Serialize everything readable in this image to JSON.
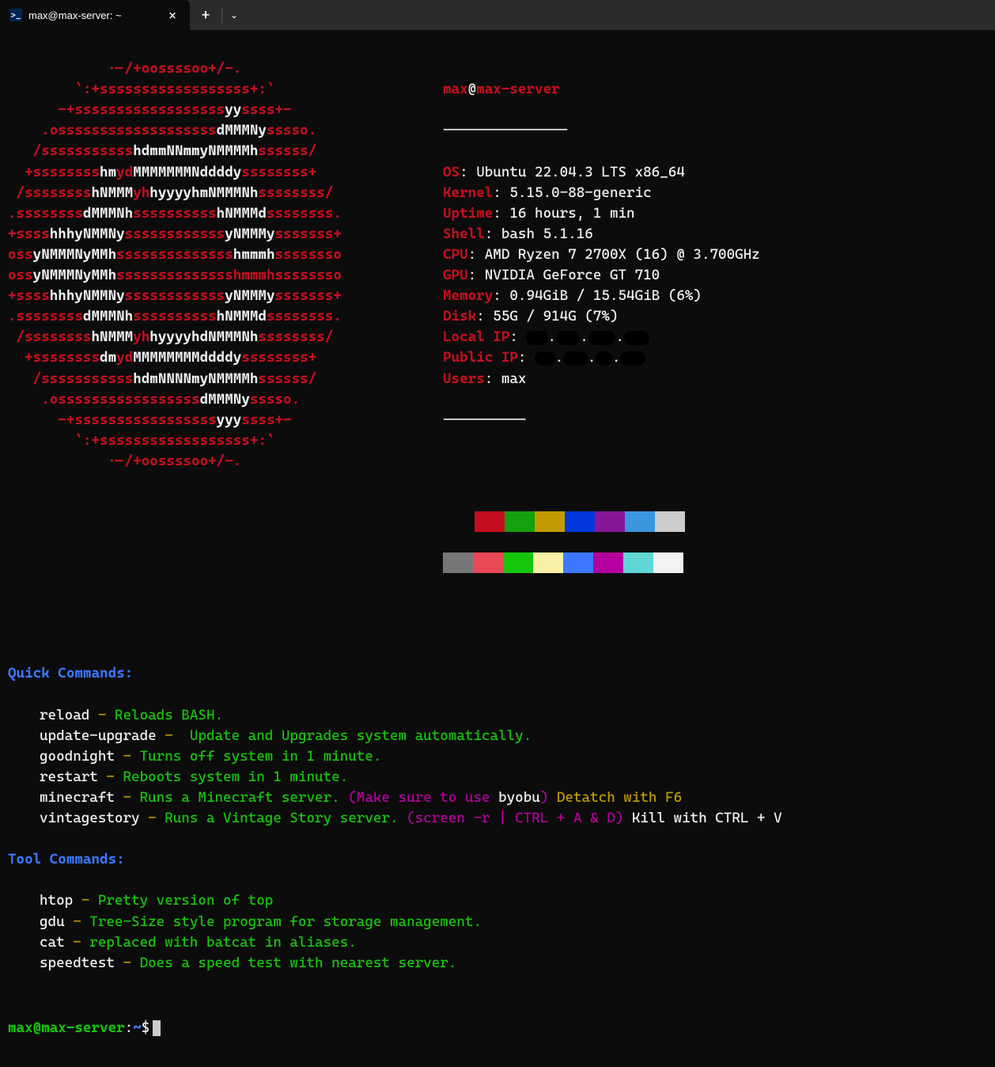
{
  "tab": {
    "title": "max@max-server: ~"
  },
  "logo": [
    [
      {
        "t": "            .-/+oossssoo+/-.",
        "c": "red"
      }
    ],
    [
      {
        "t": "        `:+ssssssssssssssssss+:`",
        "c": "red"
      }
    ],
    [
      {
        "t": "      -+ssssssssssssssssss",
        "c": "red"
      },
      {
        "t": "yy",
        "c": "wht"
      },
      {
        "t": "ssss+-",
        "c": "red"
      }
    ],
    [
      {
        "t": "    .osssssssssssssssssss",
        "c": "red"
      },
      {
        "t": "dMMMNy",
        "c": "wht"
      },
      {
        "t": "sssso.",
        "c": "red"
      }
    ],
    [
      {
        "t": "   /sssssssssss",
        "c": "red"
      },
      {
        "t": "hdmmNNmmyNMMMMh",
        "c": "wht"
      },
      {
        "t": "ssssss/",
        "c": "red"
      }
    ],
    [
      {
        "t": "  +ssssssss",
        "c": "red"
      },
      {
        "t": "hm",
        "c": "wht"
      },
      {
        "t": "yd",
        "c": "red"
      },
      {
        "t": "MMMMMMMNddddy",
        "c": "wht"
      },
      {
        "t": "ssssssss+",
        "c": "red"
      }
    ],
    [
      {
        "t": " /ssssssss",
        "c": "red"
      },
      {
        "t": "hNMMM",
        "c": "wht"
      },
      {
        "t": "yh",
        "c": "red"
      },
      {
        "t": "hyyyyhmNMMMNh",
        "c": "wht"
      },
      {
        "t": "ssssssss/",
        "c": "red"
      }
    ],
    [
      {
        "t": ".ssssssss",
        "c": "red"
      },
      {
        "t": "dMMMNh",
        "c": "wht"
      },
      {
        "t": "ssssssssss",
        "c": "red"
      },
      {
        "t": "hNMMMd",
        "c": "wht"
      },
      {
        "t": "ssssssss.",
        "c": "red"
      }
    ],
    [
      {
        "t": "+ssss",
        "c": "red"
      },
      {
        "t": "hhhyNMMNy",
        "c": "wht"
      },
      {
        "t": "ssssssssssss",
        "c": "red"
      },
      {
        "t": "yNMMMy",
        "c": "wht"
      },
      {
        "t": "sssssss+",
        "c": "red"
      }
    ],
    [
      {
        "t": "oss",
        "c": "red"
      },
      {
        "t": "yNMMMNyMMh",
        "c": "wht"
      },
      {
        "t": "ssssssssssssss",
        "c": "red"
      },
      {
        "t": "hmmmh",
        "c": "wht"
      },
      {
        "t": "ssssssso",
        "c": "red"
      }
    ],
    [
      {
        "t": "oss",
        "c": "red"
      },
      {
        "t": "yNMMMNyMMh",
        "c": "wht"
      },
      {
        "t": "sssssssssssssshmmmh",
        "c": "red"
      },
      {
        "t": "ssssssso",
        "c": "red"
      }
    ],
    [
      {
        "t": "+ssss",
        "c": "red"
      },
      {
        "t": "hhhyNMMNy",
        "c": "wht"
      },
      {
        "t": "ssssssssssss",
        "c": "red"
      },
      {
        "t": "yNMMMy",
        "c": "wht"
      },
      {
        "t": "sssssss+",
        "c": "red"
      }
    ],
    [
      {
        "t": ".ssssssss",
        "c": "red"
      },
      {
        "t": "dMMMNh",
        "c": "wht"
      },
      {
        "t": "ssssssssss",
        "c": "red"
      },
      {
        "t": "hNMMMd",
        "c": "wht"
      },
      {
        "t": "ssssssss.",
        "c": "red"
      }
    ],
    [
      {
        "t": " /ssssssss",
        "c": "red"
      },
      {
        "t": "hNMMM",
        "c": "wht"
      },
      {
        "t": "yh",
        "c": "red"
      },
      {
        "t": "hyyyyhdNMMMNh",
        "c": "wht"
      },
      {
        "t": "ssssssss/",
        "c": "red"
      }
    ],
    [
      {
        "t": "  +ssssssss",
        "c": "red"
      },
      {
        "t": "dm",
        "c": "wht"
      },
      {
        "t": "yd",
        "c": "red"
      },
      {
        "t": "MMMMMMMMddddy",
        "c": "wht"
      },
      {
        "t": "ssssssss+",
        "c": "red"
      }
    ],
    [
      {
        "t": "   /sssssssssss",
        "c": "red"
      },
      {
        "t": "hdmNNNNmyNMMMMh",
        "c": "wht"
      },
      {
        "t": "ssssss/",
        "c": "red"
      }
    ],
    [
      {
        "t": "    .osssssssssssssssss",
        "c": "red"
      },
      {
        "t": "dMMMNy",
        "c": "wht"
      },
      {
        "t": "sssso.",
        "c": "red"
      }
    ],
    [
      {
        "t": "      -+sssssssssssssssss",
        "c": "red"
      },
      {
        "t": "yyy",
        "c": "wht"
      },
      {
        "t": "ssss+-",
        "c": "red"
      }
    ],
    [
      {
        "t": "        `:+ssssssssssssssssss+:`",
        "c": "red"
      }
    ],
    [
      {
        "t": "            .-/+oossssoo+/-.",
        "c": "red"
      }
    ]
  ],
  "header": {
    "user": "max",
    "at": "@",
    "host": "max-server",
    "sep": "---------------"
  },
  "info": [
    {
      "label": "OS",
      "value": "Ubuntu 22.04.3 LTS x86_64"
    },
    {
      "label": "Kernel",
      "value": "5.15.0-88-generic"
    },
    {
      "label": "Uptime",
      "value": "16 hours, 1 min"
    },
    {
      "label": "Shell",
      "value": "bash 5.1.16"
    },
    {
      "label": "CPU",
      "value": "AMD Ryzen 7 2700X (16) @ 3.700GHz"
    },
    {
      "label": "GPU",
      "value": "NVIDIA GeForce GT 710"
    },
    {
      "label": "Memory",
      "value": "0.94GiB / 15.54GiB (6%)"
    },
    {
      "label": "Disk",
      "value": "55G / 914G (7%)"
    },
    {
      "label": "Local IP",
      "value": "",
      "redacted": true
    },
    {
      "label": "Public IP",
      "value": "",
      "redacted": true
    },
    {
      "label": "Users",
      "value": "max"
    }
  ],
  "footer_sep": "----------",
  "swatches1": [
    "#c50f1f",
    "#13a10e",
    "#c19c00",
    "#0037da",
    "#881798",
    "#3a96dd",
    "#cccccc"
  ],
  "swatches2": [
    "#767676",
    "#e74856",
    "#16c60c",
    "#f9f1a5",
    "#3b78ff",
    "#b4009e",
    "#61d6d6",
    "#f2f2f2"
  ],
  "sections": {
    "quick_title": "Quick Commands:",
    "tool_title": "Tool Commands:",
    "quick": [
      {
        "cmd": "reload",
        "dash": " - ",
        "desc": "Reloads BASH."
      },
      {
        "cmd": "update-upgrade",
        "dash": " -  ",
        "desc": "Update and Upgrades system automatically."
      },
      {
        "cmd": "goodnight",
        "dash": " - ",
        "desc": "Turns off system in 1 minute."
      },
      {
        "cmd": "restart",
        "dash": " - ",
        "desc": "Reboots system in 1 minute."
      },
      {
        "cmd": "minecraft",
        "dash": " - ",
        "desc": "Runs a Minecraft server. ",
        "extra_pur": "(Make sure to use ",
        "extra_wht": "byobu",
        "extra_pur2": ") ",
        "extra_yel": "Detatch with F6"
      },
      {
        "cmd": "vintagestory",
        "dash": " - ",
        "desc": "Runs a Vintage Story server. ",
        "extra_pur": "(screen -r | CTRL + A & D) ",
        "extra_wht": "Kill with CTRL + V"
      }
    ],
    "tool": [
      {
        "cmd": "htop",
        "dash": " - ",
        "desc": "Pretty version of top"
      },
      {
        "cmd": "gdu",
        "dash": " - ",
        "desc": "Tree-Size style program for storage management."
      },
      {
        "cmd": "cat",
        "dash": " - ",
        "desc": "replaced with batcat in aliases."
      },
      {
        "cmd": "speedtest",
        "dash": " - ",
        "desc": "Does a speed test with nearest server."
      }
    ]
  },
  "prompt": {
    "user": "max@max-server",
    "colon": ":",
    "path": "~",
    "dollar": "$"
  }
}
